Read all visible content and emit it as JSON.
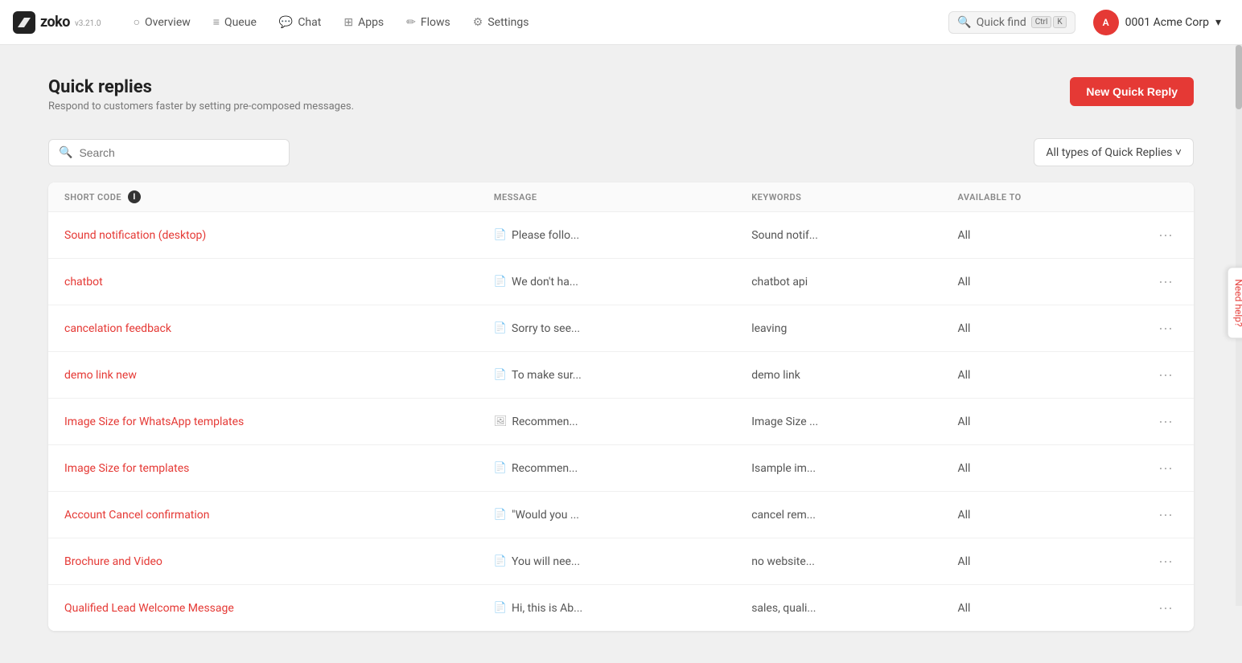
{
  "app": {
    "logo_text": "zoko",
    "logo_version": "v3.21.0"
  },
  "nav": {
    "items": [
      {
        "id": "overview",
        "icon": "○",
        "label": "Overview"
      },
      {
        "id": "queue",
        "icon": "≡",
        "label": "Queue"
      },
      {
        "id": "chat",
        "icon": "○",
        "label": "Chat"
      },
      {
        "id": "apps",
        "icon": "⊞",
        "label": "Apps"
      },
      {
        "id": "flows",
        "icon": "✏",
        "label": "Flows"
      },
      {
        "id": "settings",
        "icon": "⚙",
        "label": "Settings"
      }
    ],
    "quick_find_label": "Quick find",
    "kbd_ctrl": "Ctrl",
    "kbd_k": "K",
    "account_name": "0001 Acme Corp"
  },
  "page": {
    "title": "Quick replies",
    "subtitle": "Respond to customers faster by setting pre-composed messages.",
    "new_button_label": "New Quick Reply",
    "search_placeholder": "Search",
    "filter_label": "All types of Quick Replies ˅",
    "need_help": "Need help?"
  },
  "table": {
    "columns": [
      {
        "id": "short_code",
        "label": "SHORT CODE"
      },
      {
        "id": "message",
        "label": "MESSAGE"
      },
      {
        "id": "keywords",
        "label": "KEYWORDS"
      },
      {
        "id": "available_to",
        "label": "AVAILABLE TO"
      },
      {
        "id": "actions",
        "label": ""
      }
    ],
    "rows": [
      {
        "short_code": "Sound notification (desktop)",
        "message": "Please follo...",
        "message_icon": "doc",
        "keywords": "Sound notif...",
        "available_to": "All"
      },
      {
        "short_code": "chatbot",
        "message": "We don't ha...",
        "message_icon": "doc",
        "keywords": "chatbot api",
        "available_to": "All"
      },
      {
        "short_code": "cancelation feedback",
        "message": "Sorry to see...",
        "message_icon": "doc",
        "keywords": "leaving",
        "available_to": "All"
      },
      {
        "short_code": "demo link new",
        "message": "To make sur...",
        "message_icon": "doc",
        "keywords": "demo link",
        "available_to": "All"
      },
      {
        "short_code": "Image Size for WhatsApp templates",
        "message": "Recommen...",
        "message_icon": "img",
        "keywords": "Image Size ...",
        "available_to": "All"
      },
      {
        "short_code": "Image Size for templates",
        "message": "Recommen...",
        "message_icon": "doc",
        "keywords": "Isample im...",
        "available_to": "All"
      },
      {
        "short_code": "Account Cancel confirmation",
        "message": "\"Would you ...",
        "message_icon": "doc",
        "keywords": "cancel rem...",
        "available_to": "All"
      },
      {
        "short_code": "Brochure and Video",
        "message": "You will nee...",
        "message_icon": "doc",
        "keywords": "no website...",
        "available_to": "All"
      },
      {
        "short_code": "Qualified Lead Welcome Message",
        "message": "Hi, this is Ab...",
        "message_icon": "doc",
        "keywords": "sales, quali...",
        "available_to": "All"
      }
    ]
  }
}
